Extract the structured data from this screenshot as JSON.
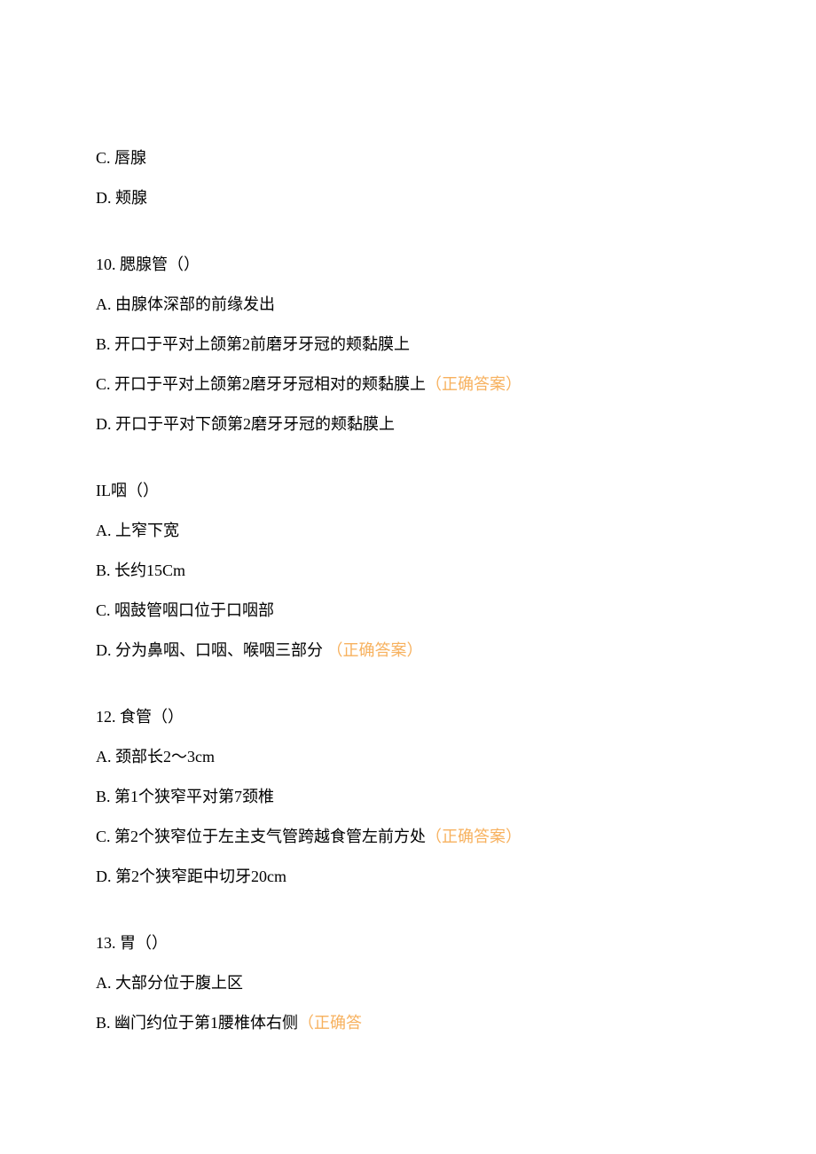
{
  "partial_q9": {
    "optC": "C. 唇腺",
    "optD": "D. 颊腺"
  },
  "q10": {
    "stem": "10. 腮腺管（）",
    "optA": "A. 由腺体深部的前缘发出",
    "optB": "B. 开口于平对上颌第2前磨牙牙冠的颊黏膜上",
    "optC_text": "C. 开口于平对上颌第2磨牙牙冠相对的颊黏膜上",
    "optC_badge": "（正确答案）",
    "optD": "D. 开口于平对下颌第2磨牙牙冠的颊黏膜上"
  },
  "q11": {
    "stem": "IL咽（）",
    "optA": "A. 上窄下宽",
    "optB": "B. 长约15Cm",
    "optC": "C. 咽鼓管咽口位于口咽部",
    "optD_text": "D. 分为鼻咽、口咽、喉咽三部分",
    "optD_badge": "（正确答案）"
  },
  "q12": {
    "stem": "12. 食管（）",
    "optA": "A. 颈部长2〜3cm",
    "optB": "B. 第1个狭窄平对第7颈椎",
    "optC_text": "C. 第2个狭窄位于左主支气管跨越食管左前方处",
    "optC_badge": "（正确答案）",
    "optD": "D. 第2个狭窄距中切牙20cm"
  },
  "q13": {
    "stem": "13. 胃（）",
    "optA": "A. 大部分位于腹上区",
    "optB_text": "B. 幽门约位于第1腰椎体右侧",
    "optB_badge": "（正确答"
  }
}
